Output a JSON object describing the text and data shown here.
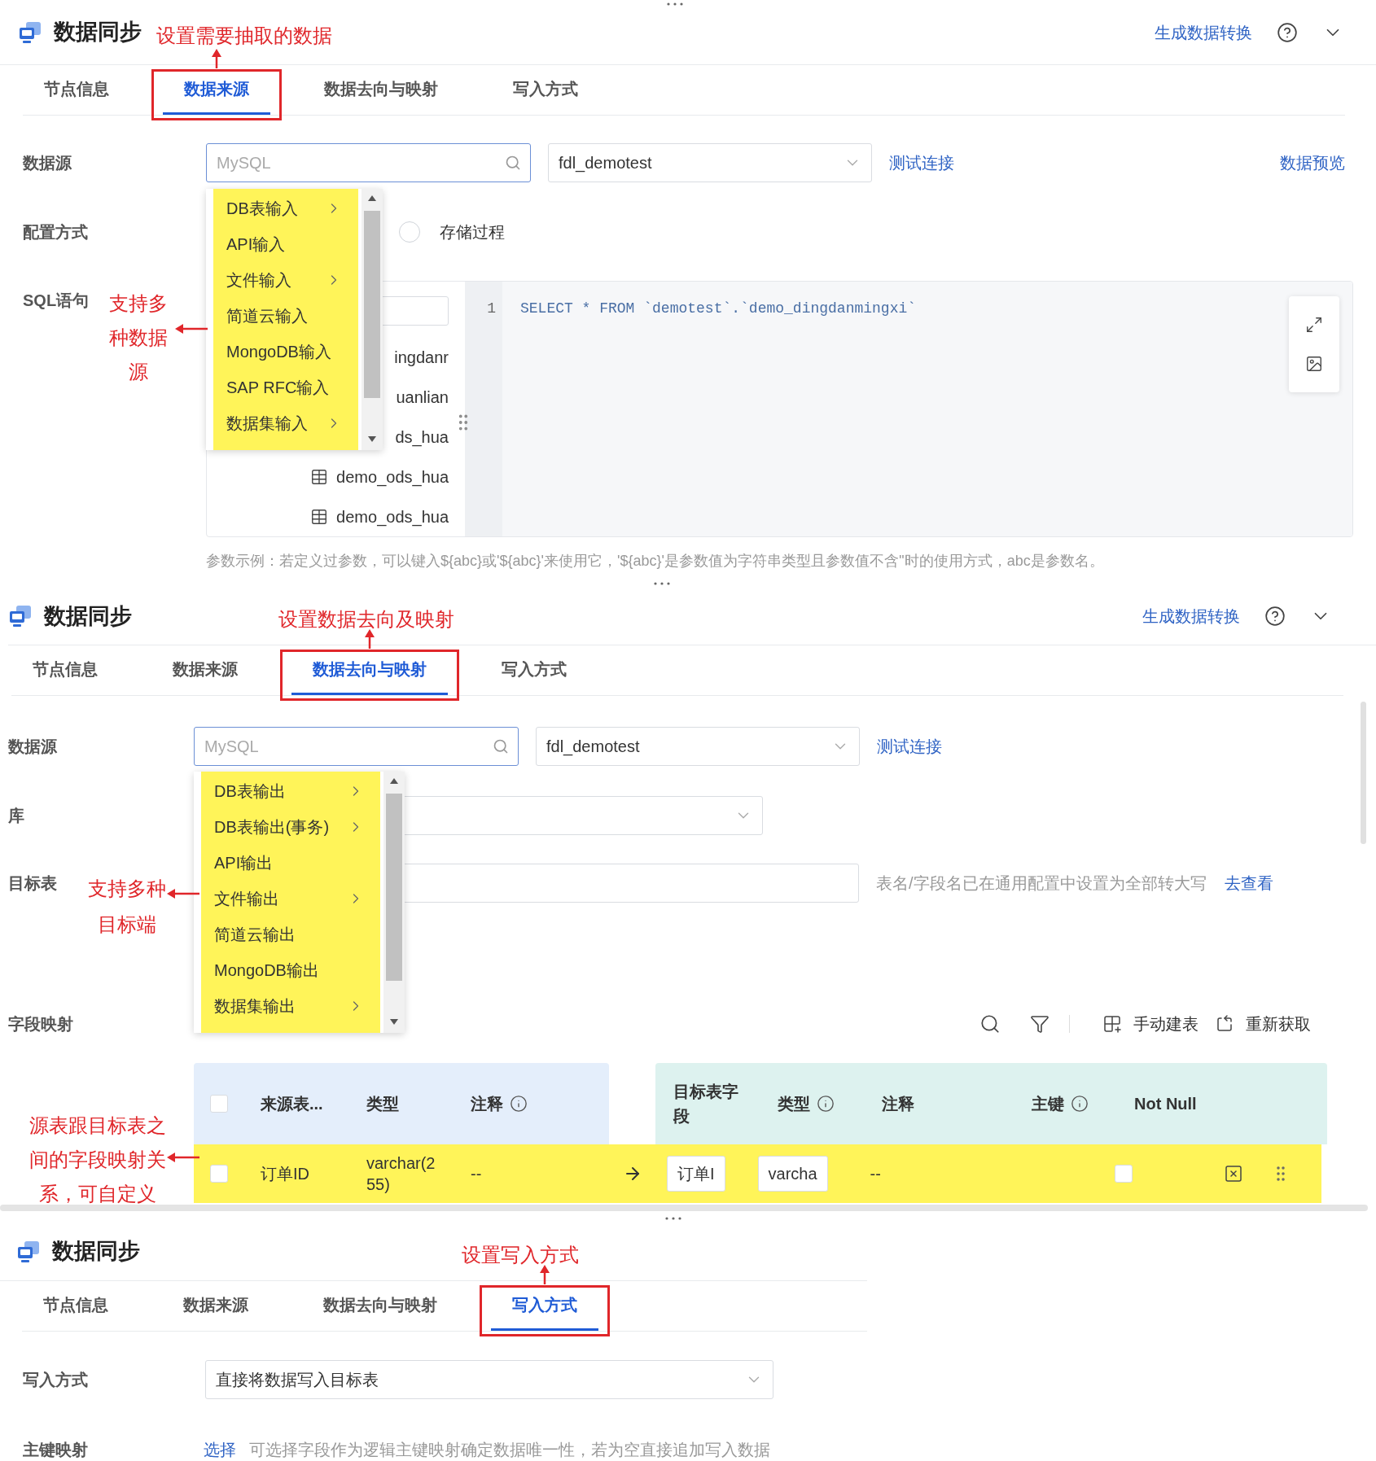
{
  "source_panel": {
    "title": "数据同步",
    "annotation": "设置需要抽取的数据",
    "header_link": "生成数据转换",
    "tabs": [
      {
        "label": "节点信息",
        "selected": false
      },
      {
        "label": "数据来源",
        "selected": true
      },
      {
        "label": "数据去向与映射",
        "selected": false
      },
      {
        "label": "写入方式",
        "selected": false
      }
    ],
    "datasource": {
      "label": "数据源",
      "placeholder": "MySQL",
      "connection": "fdl_demotest",
      "test_link": "测试连接",
      "preview_link": "数据预览"
    },
    "config": {
      "label": "配置方式",
      "option": {
        "label": "存储过程",
        "selected": false
      }
    },
    "sql": {
      "label": "SQL语句",
      "line_number": "1",
      "code": "SELECT * FROM `demotest`.`demo_dingdanmingxi`",
      "tables": [
        {
          "name": "ingdanr",
          "kind": "cut"
        },
        {
          "name": "uanlian",
          "kind": "cut"
        },
        {
          "name": "ds_hua",
          "kind": "cut"
        },
        {
          "name": "demo_ods_hua",
          "kind": "table"
        },
        {
          "name": "demo_ods_hua",
          "kind": "table"
        }
      ]
    },
    "hint": "参数示例：若定义过参数，可以键入${abc}或'${abc}'来使用它，'${abc}'是参数值为字符串类型且参数值不含''时的使用方式，abc是参数名。",
    "menu": [
      {
        "label": "DB表输入",
        "submenu": true
      },
      {
        "label": "API输入",
        "submenu": false
      },
      {
        "label": "文件输入",
        "submenu": true
      },
      {
        "label": "简道云输入",
        "submenu": false
      },
      {
        "label": "MongoDB输入",
        "submenu": false
      },
      {
        "label": "SAP RFC输入",
        "submenu": false
      },
      {
        "label": "数据集输入",
        "submenu": true
      }
    ],
    "side_annotation": "支持多种数据源"
  },
  "target_panel": {
    "title": "数据同步",
    "annotation": "设置数据去向及映射",
    "header_link": "生成数据转换",
    "tabs": [
      {
        "label": "节点信息",
        "selected": false
      },
      {
        "label": "数据来源",
        "selected": false
      },
      {
        "label": "数据去向与映射",
        "selected": true
      },
      {
        "label": "写入方式",
        "selected": false
      }
    ],
    "datasource": {
      "label": "数据源",
      "placeholder": "MySQL",
      "connection": "fdl_demotest",
      "test_link": "测试连接"
    },
    "database": {
      "label": "库"
    },
    "target_table": {
      "label": "目标表",
      "hint": "表名/字段名已在通用配置中设置为全部转大写",
      "link": "去查看"
    },
    "mapping": {
      "label": "字段映射",
      "actions": [
        {
          "label": "手动建表",
          "kind": "create"
        },
        {
          "label": "重新获取",
          "kind": "refresh"
        }
      ],
      "header_checked": false,
      "source_columns": [
        {
          "label": "来源表...",
          "info": false
        },
        {
          "label": "类型",
          "info": false
        },
        {
          "label": "注释",
          "info": true
        }
      ],
      "target_columns": [
        {
          "label": "目标表字段",
          "info": false
        },
        {
          "label": "类型",
          "info": true
        },
        {
          "label": "注释",
          "info": false
        },
        {
          "label": "主键",
          "info": true
        },
        {
          "label": "Not Null",
          "info": false
        }
      ],
      "rows": [
        {
          "checked": false,
          "highlighted": true,
          "source_field": "订单ID",
          "source_type": "varchar(255)",
          "source_comment": "--",
          "target_field": "订单I",
          "target_type": "varcha",
          "target_comment": "--",
          "not_null": false
        }
      ]
    },
    "menu": [
      {
        "label": "DB表输出",
        "submenu": true
      },
      {
        "label": "DB表输出(事务)",
        "submenu": true
      },
      {
        "label": "API输出",
        "submenu": false
      },
      {
        "label": "文件输出",
        "submenu": true
      },
      {
        "label": "简道云输出",
        "submenu": false
      },
      {
        "label": "MongoDB输出",
        "submenu": false
      },
      {
        "label": "数据集输出",
        "submenu": true
      }
    ],
    "side_annotation_top": "支持多种目标端",
    "side_annotation_bottom": "源表跟目标表之间的字段映射关系，可自定义"
  },
  "write_panel": {
    "title": "数据同步",
    "annotation": "设置写入方式",
    "tabs": [
      {
        "label": "节点信息",
        "selected": false
      },
      {
        "label": "数据来源",
        "selected": false
      },
      {
        "label": "数据去向与映射",
        "selected": false
      },
      {
        "label": "写入方式",
        "selected": true
      }
    ],
    "write_mode": {
      "label": "写入方式",
      "value": "直接将数据写入目标表"
    },
    "key_mapping": {
      "label": "主键映射",
      "link": "选择",
      "hint": "可选择字段作为逻辑主键映射确定数据唯一性，若为空直接追加写入数据"
    }
  }
}
